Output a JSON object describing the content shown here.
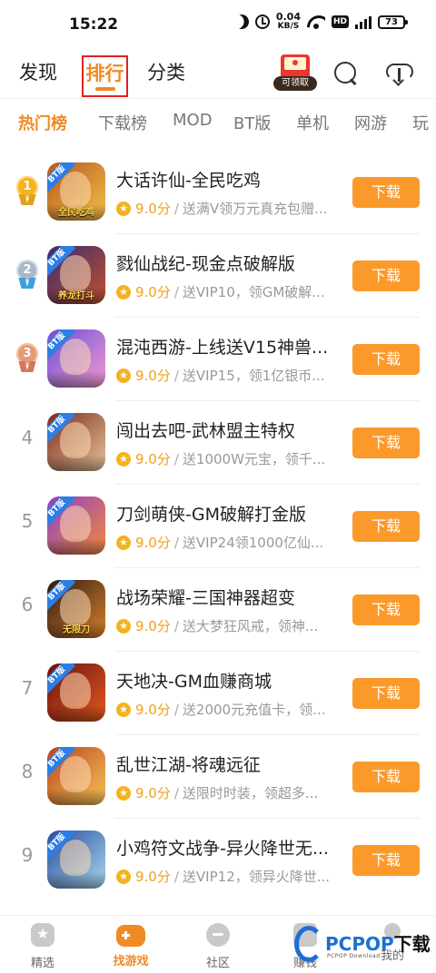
{
  "status_bar": {
    "time": "15:22",
    "net_speed": "0.04",
    "net_unit": "KB/S",
    "hd": "HD",
    "signal": "5G",
    "battery": "73"
  },
  "top_nav": {
    "tabs": [
      {
        "label": "发现",
        "active": false
      },
      {
        "label": "排行",
        "active": true
      },
      {
        "label": "分类",
        "active": false
      }
    ],
    "gift_label": "可领取",
    "accent": "#f08a24",
    "highlight_border": "#e02020"
  },
  "sub_tabs": [
    {
      "label": "热门榜",
      "active": true
    },
    {
      "label": "下载榜",
      "active": false
    },
    {
      "label": "MOD",
      "active": false
    },
    {
      "label": "BT版",
      "active": false
    },
    {
      "label": "单机",
      "active": false
    },
    {
      "label": "网游",
      "active": false
    },
    {
      "label": "玩",
      "active": false
    }
  ],
  "games": [
    {
      "rank": "1",
      "title": "大话许仙-全民吃鸡",
      "score": "9.0分",
      "desc": "送满V领万元真充包赠...",
      "bt": "BT版",
      "caption": "全民吃鸡",
      "download": "下载",
      "icon_colors": [
        "#b6561c",
        "#f3c04a"
      ]
    },
    {
      "rank": "2",
      "title": "戮仙战纪-现金点破解版",
      "score": "9.0分",
      "desc": "送VIP10，领GM破解...",
      "bt": "BT版",
      "caption": "养龙打斗",
      "download": "下载",
      "icon_colors": [
        "#3a2b6e",
        "#c0512e"
      ]
    },
    {
      "rank": "3",
      "title": "混沌西游-上线送V15神兽...",
      "score": "9.0分",
      "desc": "送VIP15，领1亿银币...",
      "bt": "BT版",
      "caption": "",
      "download": "下载",
      "icon_colors": [
        "#6a4fd8",
        "#f29ad0"
      ]
    },
    {
      "rank": "4",
      "title": "闯出去吧-武林盟主特权",
      "score": "9.0分",
      "desc": "送1000W元宝，领千...",
      "bt": "BT版",
      "caption": "",
      "download": "下载",
      "icon_colors": [
        "#7a2a1e",
        "#e8c49a"
      ]
    },
    {
      "rank": "5",
      "title": "刀剑萌侠-GM破解打金版",
      "score": "9.0分",
      "desc": "送VIP24领1000亿仙...",
      "bt": "BT版",
      "caption": "",
      "download": "下载",
      "icon_colors": [
        "#8e3fc8",
        "#f48a3a"
      ]
    },
    {
      "rank": "6",
      "title": "战场荣耀-三国神器超变",
      "score": "9.0分",
      "desc": "送大梦狂风戒，领神...",
      "bt": "BT版",
      "caption": "无限刀",
      "download": "下载",
      "icon_colors": [
        "#2a1a12",
        "#d9822b"
      ]
    },
    {
      "rank": "7",
      "title": "天地决-GM血赚商城",
      "score": "9.0分",
      "desc": "送2000元充值卡，领...",
      "bt": "BT版",
      "caption": "",
      "download": "下载",
      "icon_colors": [
        "#6a1010",
        "#e45b1f"
      ]
    },
    {
      "rank": "8",
      "title": "乱世江湖-将魂远征",
      "score": "9.0分",
      "desc": "送限时时装，领超多...",
      "bt": "BT版",
      "caption": "",
      "download": "下载",
      "icon_colors": [
        "#b8451c",
        "#f7c35a"
      ]
    },
    {
      "rank": "9",
      "title": "小鸡符文战争-异火降世无...",
      "score": "9.0分",
      "desc": "送VIP12，领异火降世...",
      "bt": "BT版",
      "caption": "",
      "download": "下载",
      "icon_colors": [
        "#2a4a9a",
        "#a8d8f0"
      ]
    }
  ],
  "bottom_nav": [
    {
      "label": "精选",
      "icon": "star-icon",
      "active": false
    },
    {
      "label": "找游戏",
      "icon": "gamepad-icon",
      "active": true
    },
    {
      "label": "社区",
      "icon": "chat-icon",
      "active": false
    },
    {
      "label": "赚钱",
      "icon": "wallet-icon",
      "active": false
    },
    {
      "label": "我的",
      "icon": "user-icon",
      "active": false
    }
  ],
  "watermark": {
    "brand": "PCPOP",
    "brand_cn": "下载",
    "sub": "PCPOP Download"
  },
  "colors": {
    "download_button": "#fb9a2b",
    "score": "#f0a01e",
    "bt_tag": "#2d7de4"
  }
}
